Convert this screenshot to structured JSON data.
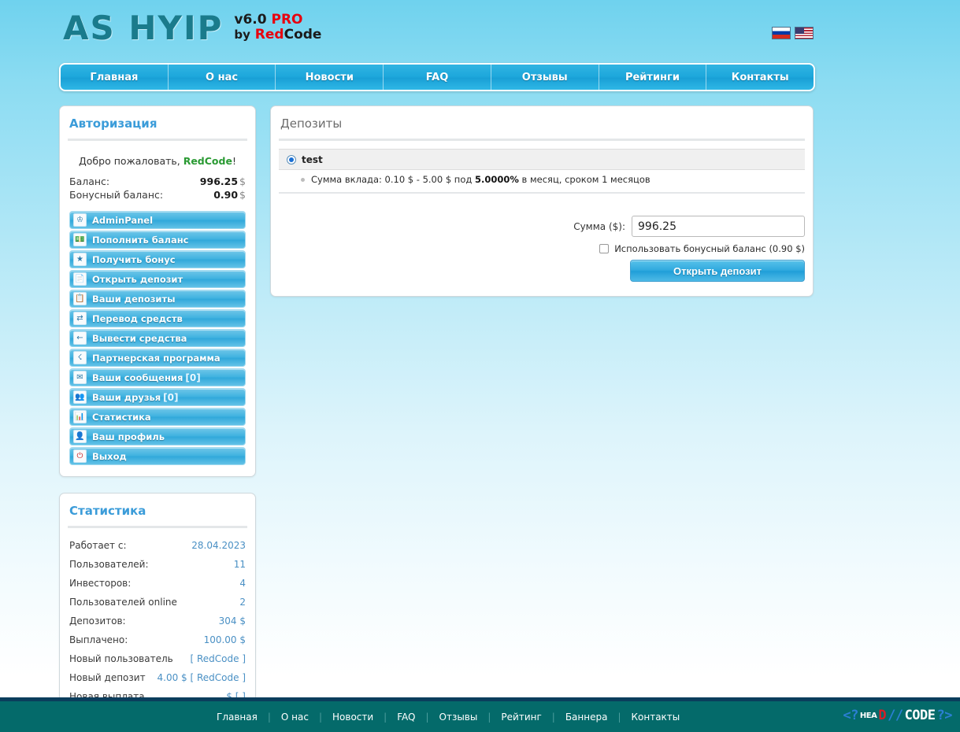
{
  "header": {
    "logo_main": "AS HYIP",
    "logo_version": "v6.0",
    "logo_pro": "PRO",
    "logo_by": "by",
    "logo_red": "Red",
    "logo_code": "Code",
    "flags": [
      {
        "name": "russian-flag",
        "label": "RU"
      },
      {
        "name": "us-flag",
        "label": "EN"
      }
    ]
  },
  "nav": {
    "items": [
      "Главная",
      "О нас",
      "Новости",
      "FAQ",
      "Отзывы",
      "Рейтинги",
      "Контакты"
    ]
  },
  "sidebar": {
    "auth": {
      "title": "Авторизация",
      "welcome_prefix": "Добро пожаловать, ",
      "welcome_user": "RedCode",
      "welcome_suffix": "!",
      "balance_label": "Баланс:",
      "balance_value": "996.25",
      "balance_currency": "$",
      "bonus_label": "Бонусный баланс:",
      "bonus_value": "0.90",
      "bonus_currency": "$",
      "menu": [
        {
          "icon": "crown-icon",
          "label": "AdminPanel",
          "count": ""
        },
        {
          "icon": "money-add-icon",
          "label": "Пополнить баланс",
          "count": ""
        },
        {
          "icon": "gift-icon",
          "label": "Получить бонус",
          "count": ""
        },
        {
          "icon": "new-file-icon",
          "label": "Открыть депозит",
          "count": ""
        },
        {
          "icon": "copy-icon",
          "label": "Ваши депозиты",
          "count": ""
        },
        {
          "icon": "transfer-icon",
          "label": "Перевод средств",
          "count": ""
        },
        {
          "icon": "withdraw-icon",
          "label": "Вывести средства",
          "count": ""
        },
        {
          "icon": "network-icon",
          "label": "Партнерская программа",
          "count": ""
        },
        {
          "icon": "mail-icon",
          "label": "Ваши сообщения",
          "count": "[0]"
        },
        {
          "icon": "friends-icon",
          "label": "Ваши друзья",
          "count": "[0]"
        },
        {
          "icon": "chart-icon",
          "label": "Статистика",
          "count": ""
        },
        {
          "icon": "user-icon",
          "label": "Ваш профиль",
          "count": ""
        },
        {
          "icon": "power-icon",
          "label": "Выход",
          "count": ""
        }
      ]
    },
    "stats": {
      "title": "Статистика",
      "rows": [
        {
          "label": "Работает с:",
          "value": "28.04.2023"
        },
        {
          "label": "Пользователей:",
          "value": "11"
        },
        {
          "label": "Инвесторов:",
          "value": "4"
        },
        {
          "label": "Пользователей online",
          "value": "2"
        },
        {
          "label": "Депозитов:",
          "value": "304 $"
        },
        {
          "label": "Выплачено:",
          "value": "100.00 $"
        },
        {
          "label": "Новый пользователь",
          "value": "[ RedCode ]"
        },
        {
          "label": "Новый депозит",
          "value": "4.00 $ [ RedCode ]"
        },
        {
          "label": "Новая выплата",
          "value": "$ [ ]"
        }
      ]
    }
  },
  "main": {
    "title": "Депозиты",
    "plan": {
      "name": "test",
      "description_prefix": "Сумма вклада: 0.10 $ - 5.00 $ под ",
      "description_rate": "5.0000%",
      "description_suffix": " в месяц, сроком 1 месяцов",
      "selected": true
    },
    "form": {
      "amount_label": "Сумма ($):",
      "amount_value": "996.25",
      "amount_placeholder": "",
      "bonus_checkbox_label": "Использовать бонусный баланс (0.90 $)",
      "bonus_checked": false,
      "submit_label": "Открыть депозит"
    }
  },
  "footer": {
    "links": [
      "Главная",
      "О нас",
      "Новости",
      "FAQ",
      "Отзывы",
      "Рейтинг",
      "Баннера",
      "Контакты"
    ],
    "separator": "|",
    "logo": {
      "open": "<?",
      "hea": "HEA",
      "d": "D",
      "slash": "//",
      "code": "CODE",
      "close": "?>"
    }
  },
  "colors": {
    "accent_blue": "#3b9cd9",
    "nav_blue": "#1ea8dc",
    "footer_teal": "#046a6a",
    "footer_border": "#0b3d5c",
    "logo_teal": "#1a7b8c",
    "red": "#e8000d",
    "green": "#2a9a33",
    "stat_value": "#4a90c4"
  }
}
